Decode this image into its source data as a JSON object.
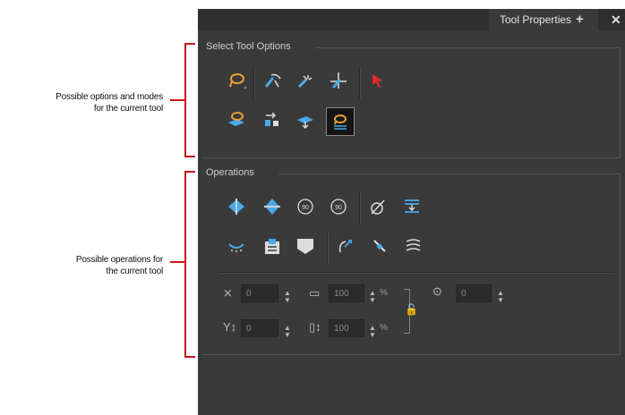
{
  "annotations": {
    "options_line1": "Possible options and modes",
    "options_line2": "for the current tool",
    "operations_line1": "Possible operations for",
    "operations_line2": "the current tool"
  },
  "panel": {
    "tab_title": "Tool Properties",
    "add_icon": "plus-icon",
    "close_icon": "close-icon"
  },
  "select_options": {
    "title": "Select Tool Options",
    "row1": [
      "lasso-icon",
      "select-transform-icon",
      "select-brush-icon",
      "select-pencil-icon",
      "red-arrow-icon"
    ],
    "row2": [
      "lasso-layer-icon",
      "cut-icon",
      "apply-layer-icon",
      "lasso-selected-icon"
    ]
  },
  "operations": {
    "title": "Operations",
    "row1": [
      "flip-horizontal-icon",
      "flip-vertical-icon",
      "rotate-90-cw-icon",
      "rotate-90-ccw-icon",
      "dropper-icon",
      "flatten-icon"
    ],
    "row2": [
      "smooth-icon",
      "distribute-icon",
      "create-color-art-icon",
      "bend-icon",
      "cutter-icon",
      "contour-icon"
    ],
    "fields": {
      "x_value": "0",
      "y_value": "0",
      "width_value": "100",
      "height_value": "100",
      "angle_value": "0",
      "percent": "%"
    },
    "colors": {
      "accent": "#e8a23a",
      "blue": "#49a9e9",
      "red": "#e02a2a"
    }
  }
}
